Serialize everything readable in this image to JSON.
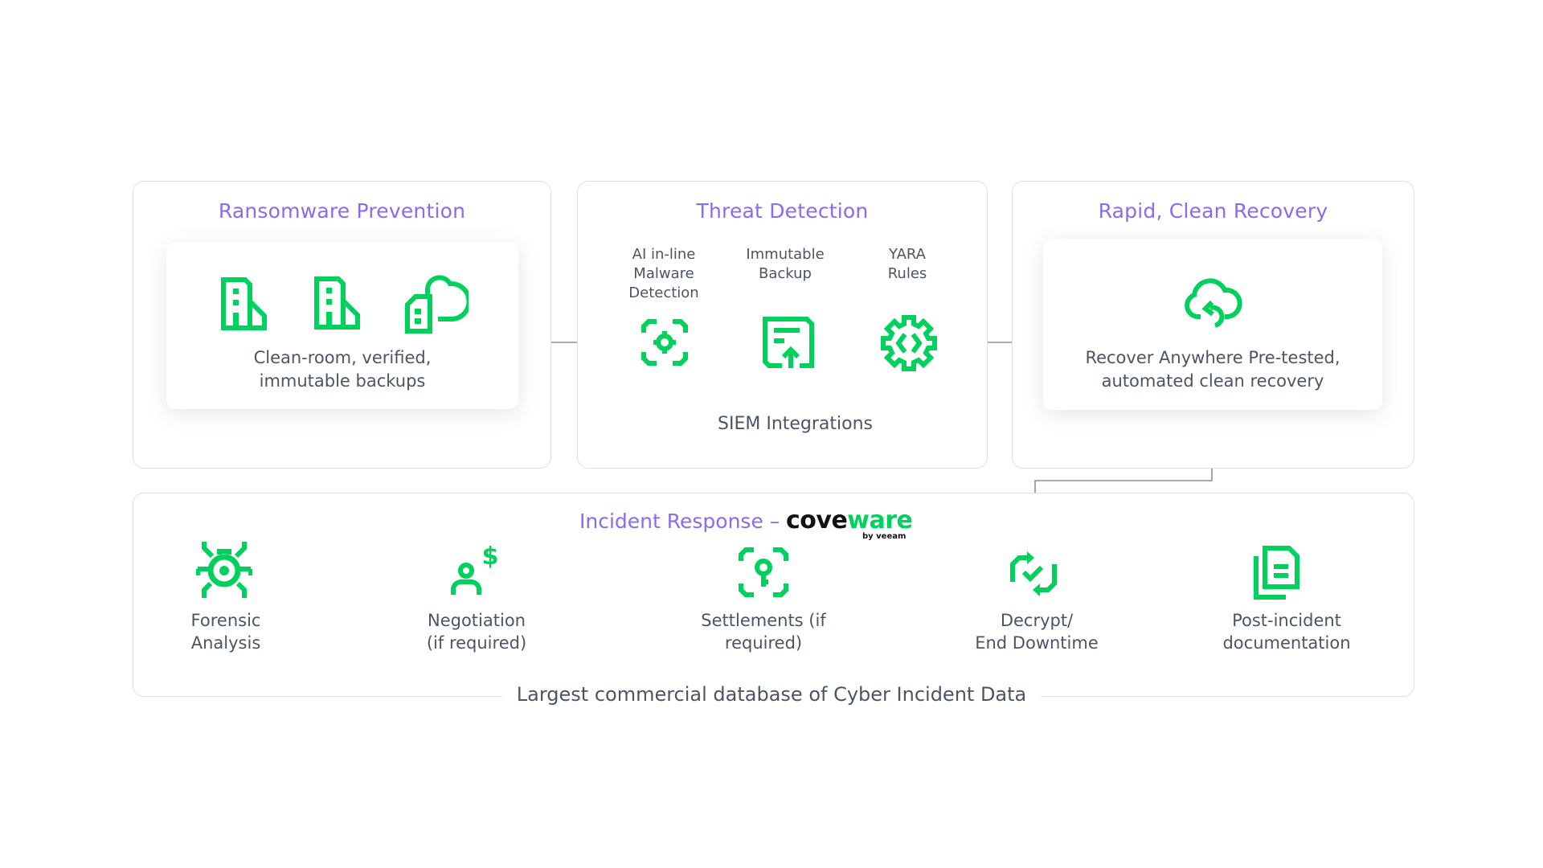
{
  "colors": {
    "accent_purple": "#8a6bf0",
    "icon_green": "#00d15c",
    "text": "#4b5563",
    "line": "#8a929c"
  },
  "prevention": {
    "title": "Ransomware Prevention",
    "icons": [
      "building-icon",
      "building-icon",
      "cloud-building-icon"
    ],
    "text_line1": "Clean-room, verified,",
    "text_line2": "immutable backups"
  },
  "detection": {
    "title": "Threat Detection",
    "items": [
      {
        "icon": "scan-target-icon",
        "label_lines": [
          "AI in-line",
          "Malware",
          "Detection"
        ]
      },
      {
        "icon": "backup-document-icon",
        "label_lines": [
          "Immutable",
          "Backup"
        ]
      },
      {
        "icon": "code-gear-icon",
        "label_lines": [
          "YARA",
          "Rules"
        ]
      }
    ],
    "siem_label": "SIEM Integrations"
  },
  "recovery": {
    "title": "Rapid, Clean Recovery",
    "icon": "cloud-recovery-icon",
    "text_line1": "Recover Anywhere Pre-tested,",
    "text_line2": "automated clean recovery"
  },
  "incident": {
    "title": "Incident Response –",
    "brand_part1": "cove",
    "brand_part2": "ware",
    "brand_sub": "by veeam",
    "steps": [
      {
        "icon": "bug-icon",
        "line1": "Forensic",
        "line2": "Analysis"
      },
      {
        "icon": "person-dollar-icon",
        "line1": "Negotiation",
        "line2": "(if required)"
      },
      {
        "icon": "key-scan-icon",
        "line1": "Settlements (if",
        "line2": "required)"
      },
      {
        "icon": "sync-check-icon",
        "line1": "Decrypt/",
        "line2": "End Downtime"
      },
      {
        "icon": "documents-icon",
        "line1": "Post-incident",
        "line2": "documentation"
      }
    ],
    "caption": "Largest commercial database of Cyber Incident Data"
  }
}
